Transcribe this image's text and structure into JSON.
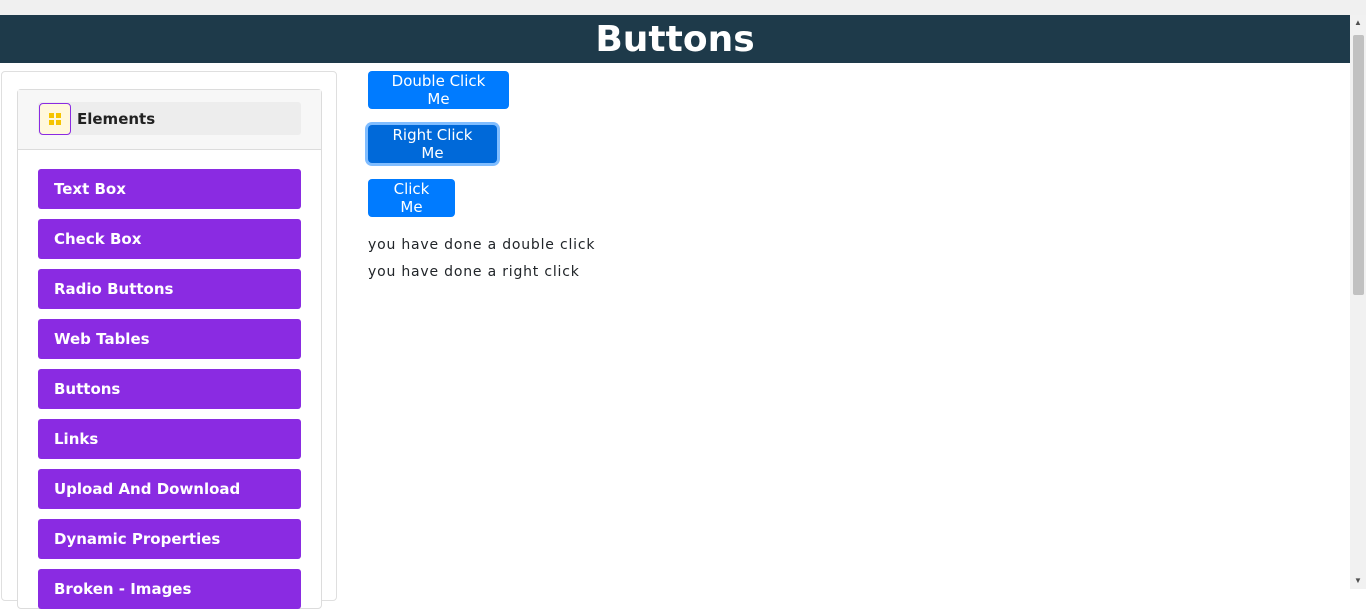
{
  "header": {
    "title": "Buttons"
  },
  "sidebar": {
    "group_title": "Elements",
    "items": [
      {
        "label": "Text Box"
      },
      {
        "label": "Check Box"
      },
      {
        "label": "Radio Buttons"
      },
      {
        "label": "Web Tables"
      },
      {
        "label": "Buttons"
      },
      {
        "label": "Links"
      },
      {
        "label": "Upload And Download"
      },
      {
        "label": "Dynamic Properties"
      },
      {
        "label": "Broken - Images"
      }
    ]
  },
  "main": {
    "double_click_label": "Double Click Me",
    "right_click_label": "Right Click Me",
    "click_label": "Click Me",
    "double_click_message": "you have done a double click",
    "right_click_message": "you have done a right click"
  },
  "colors": {
    "header_bg": "#1e3a4a",
    "sidebar_item_bg": "#8a2be2",
    "button_bg": "#007bff"
  }
}
